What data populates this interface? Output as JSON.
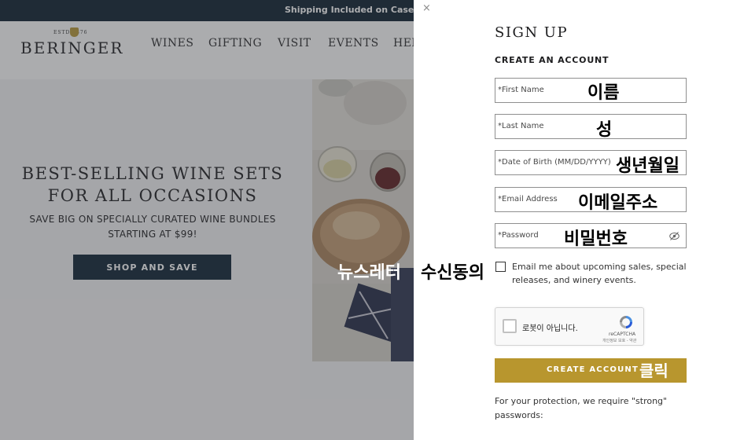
{
  "promo": {
    "text": "Shipping Included on Cases | $"
  },
  "brand": {
    "estd": "ESTD 1876",
    "name": "BERINGER"
  },
  "nav": {
    "items": [
      "WINES",
      "GIFTING",
      "VISIT",
      "EVENTS",
      "HEL"
    ]
  },
  "hero": {
    "title_line1": "BEST-SELLING WINE SETS",
    "title_line2": "FOR ALL OCCASIONS",
    "sub_line1": "SAVE BIG ON SPECIALLY CURATED WINE BUNDLES",
    "sub_line2": "STARTING AT $99!",
    "cta": "SHOP AND SAVE"
  },
  "signup": {
    "close": "×",
    "title": "SIGN UP",
    "subtitle": "CREATE AN ACCOUNT",
    "fields": {
      "first_name": {
        "placeholder": "*First Name",
        "annotation": "이름"
      },
      "last_name": {
        "placeholder": "*Last Name",
        "annotation": "성"
      },
      "dob": {
        "placeholder": "*Date of Birth (MM/DD/YYYY)",
        "annotation": "생년월일"
      },
      "email": {
        "placeholder": "*Email Address",
        "annotation": "이메일주소"
      },
      "password": {
        "placeholder": "*Password",
        "annotation": "비밀번호"
      }
    },
    "newsletter": {
      "label": "Email me about upcoming sales, special releases, and winery events.",
      "annotation_part1": "뉴스레터",
      "annotation_part2": "수신동의"
    },
    "recaptcha": {
      "label": "로봇이 아닙니다.",
      "brand": "reCAPTCHA",
      "terms": "개인정보 보호 - 약관"
    },
    "create_button": {
      "label": "CREATE ACCOUNT",
      "annotation": "클릭"
    },
    "protection_note": "For your protection, we require \"strong\" passwords:"
  },
  "colors": {
    "promo_bar": "#0b1e2d",
    "accent_gold": "#b8962e",
    "navy_button": "#0d2233"
  }
}
